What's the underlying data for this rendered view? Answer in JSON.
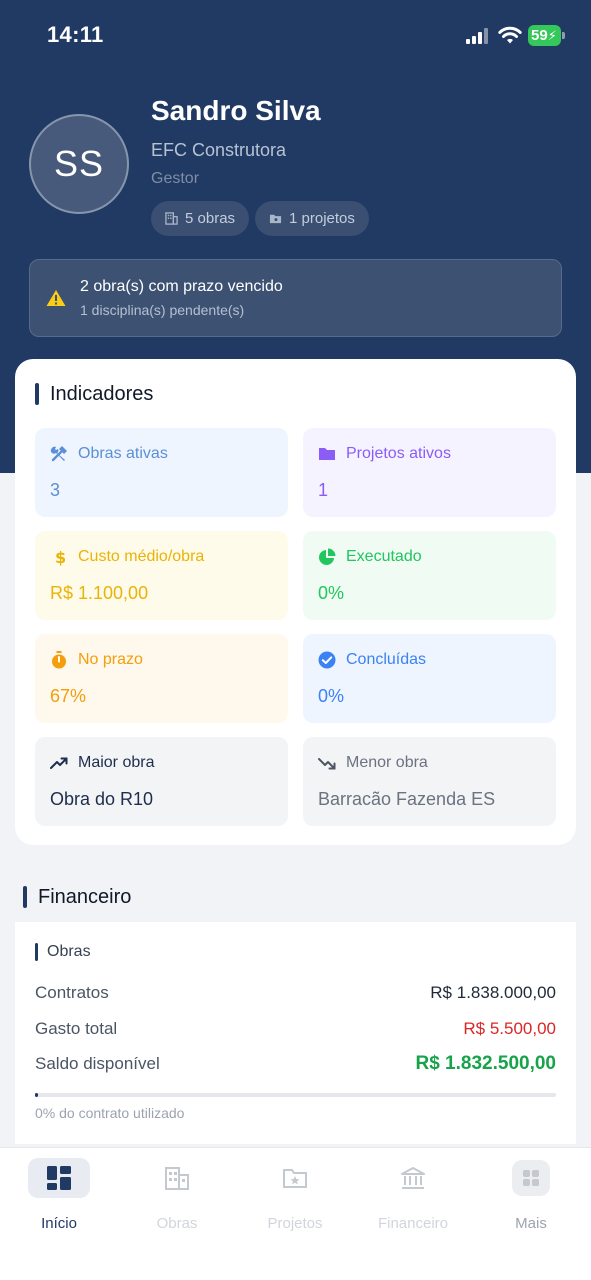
{
  "status_bar": {
    "time": "14:11",
    "battery": "59"
  },
  "profile": {
    "initials": "SS",
    "name": "Sandro Silva",
    "company": "EFC Construtora",
    "role": "Gestor",
    "chips": [
      {
        "label": "5 obras",
        "icon": "building-icon"
      },
      {
        "label": "1 projetos",
        "icon": "folder-icon"
      }
    ]
  },
  "alert": {
    "icon": "warning-icon",
    "title": "2 obra(s) com prazo vencido",
    "subtitle": "1 disciplina(s) pendente(s)"
  },
  "indicators": {
    "title": "Indicadores",
    "tiles": [
      {
        "label": "Obras ativas",
        "value": "3",
        "icon": "tools-icon",
        "color": "#5b8fd6",
        "bg": "#eff5ff"
      },
      {
        "label": "Projetos ativos",
        "value": "1",
        "icon": "folder-icon",
        "color": "#8b5cf6",
        "bg": "#f5f3ff"
      },
      {
        "label": "Custo médio/obra",
        "value": "R$ 1.100,00",
        "icon": "dollar-icon",
        "color": "#eab308",
        "bg": "#fffbea"
      },
      {
        "label": "Executado",
        "value": "0%",
        "icon": "pie-chart-icon",
        "color": "#22c55e",
        "bg": "#effbf3"
      },
      {
        "label": "No prazo",
        "value": "67%",
        "icon": "timer-icon",
        "color": "#f59e0b",
        "bg": "#fff8ec"
      },
      {
        "label": "Concluídas",
        "value": "0%",
        "icon": "check-circle-icon",
        "color": "#3b82f6",
        "bg": "#eff5ff"
      },
      {
        "label": "Maior obra",
        "value": "Obra do R10",
        "icon": "trending-up-icon",
        "color": "#1f2e4d",
        "bg": "#f3f4f6"
      },
      {
        "label": "Menor obra",
        "value": "Barracão Fazenda ES",
        "icon": "trending-down-icon",
        "color": "#6b7280",
        "bg": "#f3f4f6"
      }
    ]
  },
  "financial": {
    "title": "Financeiro",
    "subtitle": "Obras",
    "rows": [
      {
        "label": "Contratos",
        "value": "R$ 1.838.000,00",
        "color": "#1f2937"
      },
      {
        "label": "Gasto total",
        "value": "R$ 5.500,00",
        "color": "#dc2626"
      },
      {
        "label": "Saldo disponível",
        "value": "R$ 1.832.500,00",
        "color": "#16a34a"
      }
    ],
    "progress": 0.003,
    "progress_text": "0% do contrato utilizado"
  },
  "tabs": [
    {
      "label": "Início",
      "icon": "dashboard-icon",
      "active": true
    },
    {
      "label": "Obras",
      "icon": "building-icon",
      "active": false
    },
    {
      "label": "Projetos",
      "icon": "folder-star-icon",
      "active": false
    },
    {
      "label": "Financeiro",
      "icon": "bank-icon",
      "active": false
    },
    {
      "label": "Mais",
      "icon": "grid-icon",
      "active": false
    }
  ]
}
